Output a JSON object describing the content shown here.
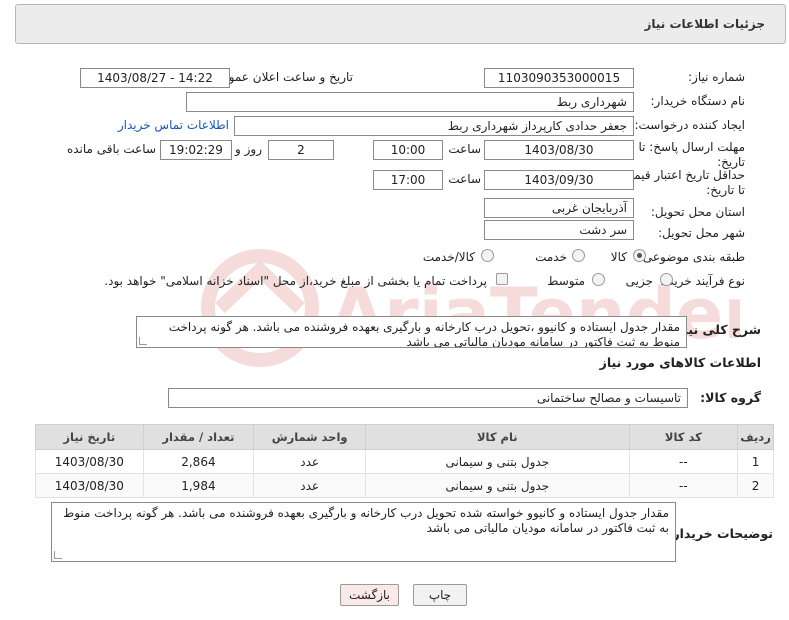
{
  "header": {
    "title": "جزئیات اطلاعات نیاز"
  },
  "form": {
    "need_number": {
      "label": "شماره نیاز:",
      "value": "1103090353000015"
    },
    "announce_datetime": {
      "label": "تاریخ و ساعت اعلان عمومی:",
      "value": "1403/08/27 - 14:22"
    },
    "buyer_org": {
      "label": "نام دستگاه خریدار:",
      "value": "شهرداری ربط"
    },
    "requester": {
      "label": "ایجاد کننده درخواست:",
      "value": "جعفر  حدادی کارپرداز شهرداری ربط",
      "contact_link": "اطلاعات تماس خریدار"
    },
    "reply_deadline": {
      "label": "مهلت ارسال پاسخ: تا تاریخ:",
      "date": "1403/08/30",
      "time_label": "ساعت",
      "time": "10:00",
      "days": "2",
      "days_label": "روز و",
      "remaining": "19:02:29",
      "remaining_label": "ساعت باقی مانده"
    },
    "price_validity": {
      "label": "حداقل تاریخ اعتبار قیمت: تا تاریخ:",
      "date": "1403/09/30",
      "time_label": "ساعت",
      "time": "17:00"
    },
    "delivery_province": {
      "label": "استان محل تحویل:",
      "value": "آذربایجان غربی"
    },
    "delivery_city": {
      "label": "شهر محل تحویل:",
      "value": "سر دشت"
    },
    "category": {
      "label": "طبقه بندی موضوعی:",
      "options": [
        "کالا",
        "خدمت",
        "کالا/خدمت"
      ],
      "selected": "کالا"
    },
    "process_type": {
      "label": "نوع فرآیند خرید :",
      "options": [
        "جزیی",
        "متوسط"
      ],
      "checkbox_text": "پرداخت تمام یا بخشی از مبلغ خرید،از محل \"اسناد خزانه اسلامی\" خواهد بود."
    },
    "description": {
      "label": "شرح کلی نیاز:",
      "value": "مقدار جدول ایستاده و کانیوو ،تحویل درب کارخانه و بارگیری بعهده فروشنده می باشد. هر گونه پرداخت منوط به ثبت فاکتور در سامانه مودیان مالیاتی می باشد"
    }
  },
  "goods": {
    "section_title": "اطلاعات کالاهای مورد نیاز",
    "group_label": "گروه کالا:",
    "group_value": "تاسیسات و مصالح ساختمانی",
    "columns": [
      "ردیف",
      "کد کالا",
      "نام کالا",
      "واحد شمارش",
      "تعداد / مقدار",
      "تاریخ نیاز"
    ],
    "rows": [
      {
        "row": "1",
        "code": "--",
        "name": "جدول بتنی و سیمانی",
        "unit": "عدد",
        "qty": "2,864",
        "date": "1403/08/30"
      },
      {
        "row": "2",
        "code": "--",
        "name": "جدول بتنی و سیمانی",
        "unit": "عدد",
        "qty": "1,984",
        "date": "1403/08/30"
      }
    ]
  },
  "buyer_notes": {
    "label": "توضیحات خریدار:",
    "value": "مقدار جدول ایستاده و کانیوو خواسته شده تحویل درب کارخانه و بارگیری بعهده فروشنده می باشد. هر گونه پرداخت منوط به ثبت فاکتور در سامانه مودیان مالیاتی می باشد"
  },
  "buttons": {
    "print": "چاپ",
    "back": "بازگشت"
  },
  "watermark": {
    "text": "AriaTender.net"
  },
  "colors": {
    "link": "#1a55b5",
    "back_button": "#fbe8e8",
    "watermark": "#d33b3b"
  }
}
